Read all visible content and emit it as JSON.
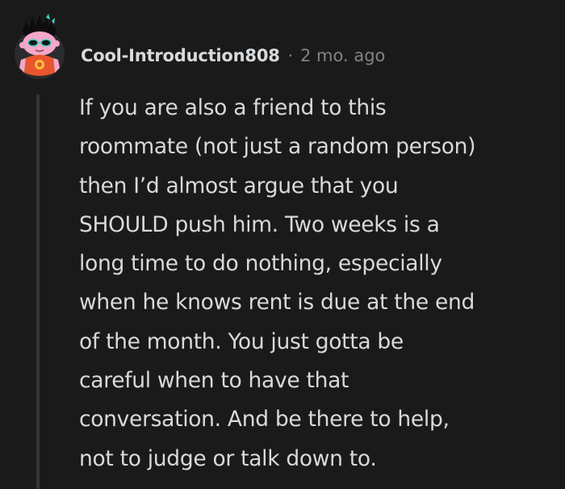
{
  "comment": {
    "author": "Cool-Introduction808",
    "separator": "·",
    "timestamp": "2 mo. ago",
    "avatar_icon": "snoo-avatar-icon",
    "body_lines": [
      "If you are also a friend to this",
      "roommate (not just a random person)",
      "then I’d almost argue that you",
      "SHOULD push him. Two weeks is a",
      "long time to do nothing, especially",
      "when he knows rent is due at the end",
      "of the month. You just gotta be",
      "careful when to have that",
      "conversation. And be there to help,",
      "not to judge or talk down to."
    ]
  },
  "colors": {
    "background": "#1a1a1b",
    "text_primary": "#d7dadc",
    "text_muted": "#818384",
    "thread_line": "#343536"
  }
}
